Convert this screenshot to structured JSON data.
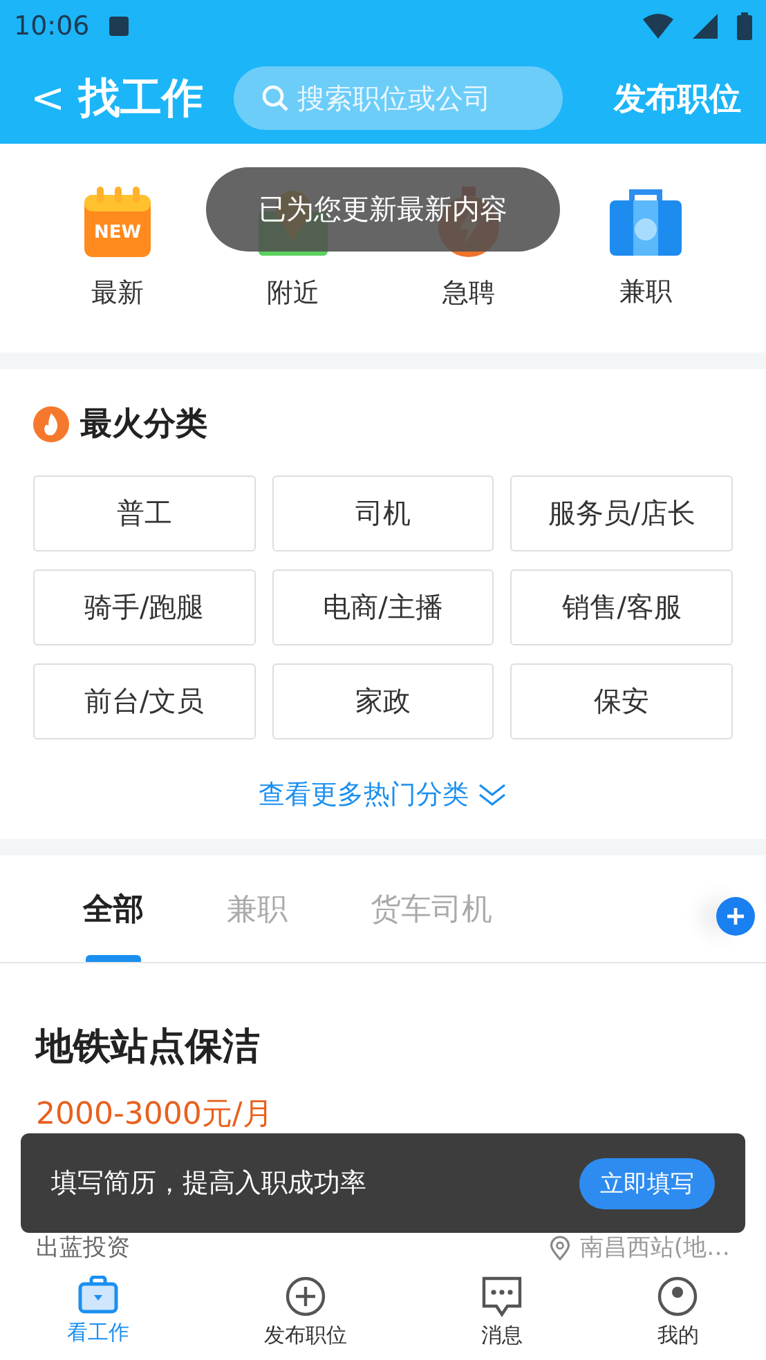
{
  "status_bar": {
    "time": "10:06"
  },
  "header": {
    "back": "<",
    "title": "找工作",
    "search": {
      "placeholder": "搜索职位或公司"
    },
    "action": "发布职位"
  },
  "quick_entries": [
    {
      "kind": "new",
      "label": "最新",
      "badge": "NEW"
    },
    {
      "kind": "nearby",
      "label": "附近"
    },
    {
      "kind": "urgent",
      "label": "急聘"
    },
    {
      "kind": "parttime",
      "label": "兼职"
    }
  ],
  "toast": "已为您更新最新内容",
  "hot_categories": {
    "title": "最火分类",
    "items": [
      "普工",
      "司机",
      "服务员/店长",
      "骑手/跑腿",
      "电商/主播",
      "销售/客服",
      "前台/文员",
      "家政",
      "保安"
    ],
    "more": "查看更多热门分类"
  },
  "tabs": [
    {
      "label": "全部",
      "selected": true
    },
    {
      "label": "兼职",
      "selected": false
    },
    {
      "label": "货车司机",
      "selected": false
    }
  ],
  "job": {
    "title": "地铁站点保洁",
    "salary": "2000-3000元/月",
    "company": "出蓝投资",
    "location": "南昌西站(地…"
  },
  "banner": {
    "text": "填写简历，提高入职成功率",
    "button": "立即填写"
  },
  "bottom_nav": [
    {
      "kind": "briefcase",
      "label": "看工作",
      "selected": true
    },
    {
      "kind": "plus",
      "label": "发布职位",
      "selected": false
    },
    {
      "kind": "chat",
      "label": "消息",
      "selected": false
    },
    {
      "kind": "person",
      "label": "我的",
      "selected": false
    }
  ]
}
